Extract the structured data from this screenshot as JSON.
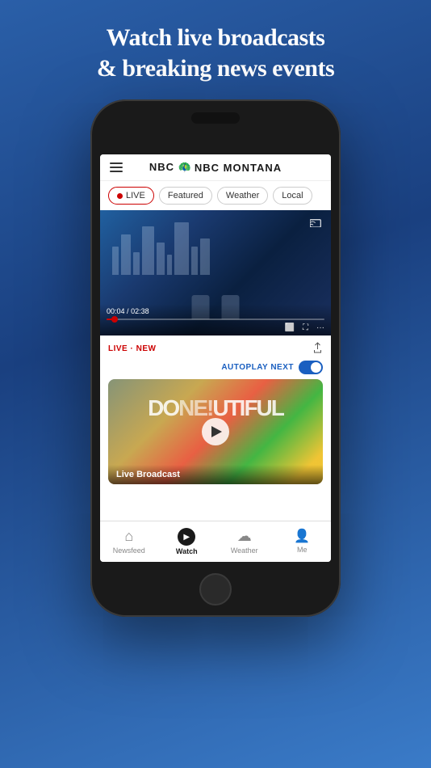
{
  "headline": {
    "line1": "Watch live broadcasts",
    "line2": "& breaking news events"
  },
  "app": {
    "title": "NBC MONTANA",
    "logo_icon": "🦚"
  },
  "filter_tabs": [
    {
      "id": "live",
      "label": "LIVE",
      "active": true,
      "has_dot": true
    },
    {
      "id": "featured",
      "label": "Featured",
      "active": false
    },
    {
      "id": "weather",
      "label": "Weather",
      "active": false
    },
    {
      "id": "local",
      "label": "Local",
      "active": false
    }
  ],
  "video_player": {
    "current_time": "00:04",
    "total_time": "02:38",
    "cast_icon": "cast"
  },
  "live_badge": "LIVE · NEW",
  "autoplay": {
    "label": "AUTOPLAY NEXT",
    "enabled": true
  },
  "video_card": {
    "title": "Live Broadcast"
  },
  "bottom_nav": [
    {
      "id": "newsfeed",
      "label": "Newsfeed",
      "icon": "⌂",
      "active": false
    },
    {
      "id": "watch",
      "label": "Watch",
      "icon": "▶",
      "active": true
    },
    {
      "id": "weather",
      "label": "Weather",
      "icon": "☁",
      "active": false
    },
    {
      "id": "me",
      "label": "Me",
      "icon": "👤",
      "active": false
    }
  ]
}
